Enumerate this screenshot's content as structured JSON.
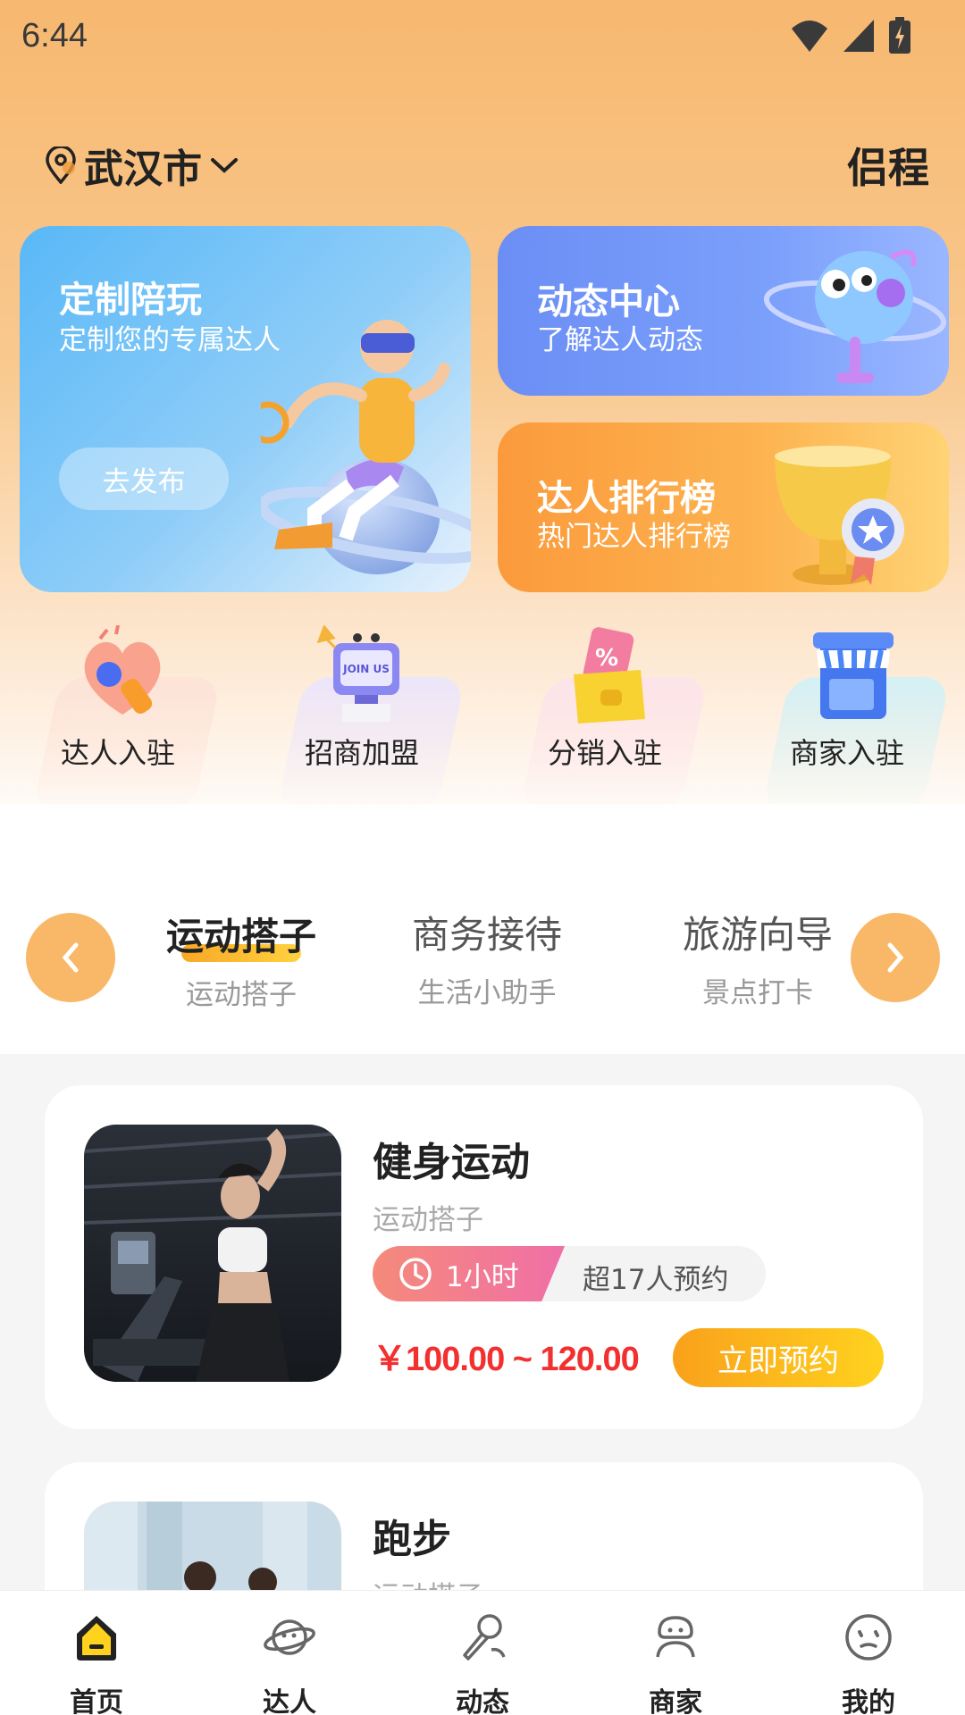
{
  "status_bar": {
    "time": "6:44"
  },
  "header": {
    "city": "武汉市",
    "brand": "侣程"
  },
  "cards": {
    "custom": {
      "title": "定制陪玩",
      "subtitle": "定制您的专属达人",
      "button": "去发布"
    },
    "dynamic": {
      "title": "动态中心",
      "subtitle": "了解达人动态"
    },
    "ranking": {
      "title": "达人排行榜",
      "subtitle": "热门达人排行榜"
    }
  },
  "quick_entries": [
    {
      "label": "达人入驻",
      "icon": "heart-megaphone-icon",
      "color": "#fde3d8"
    },
    {
      "label": "招商加盟",
      "icon": "join-us-computer-icon",
      "color": "#ece6fb"
    },
    {
      "label": "分销入驻",
      "icon": "coupon-wallet-icon",
      "color": "#fde3ea"
    },
    {
      "label": "商家入驻",
      "icon": "store-icon",
      "color": "#d9f3f7"
    }
  ],
  "categories": [
    {
      "title": "运动搭子",
      "subtitle": "运动搭子",
      "active": true
    },
    {
      "title": "商务接待",
      "subtitle": "生活小助手",
      "active": false
    },
    {
      "title": "旅游向导",
      "subtitle": "景点打卡",
      "active": false
    }
  ],
  "items": [
    {
      "title": "健身运动",
      "category": "运动搭子",
      "duration": "1小时",
      "bookings": "超17人预约",
      "price": "￥100.00 ~ 120.00",
      "button": "立即预约"
    },
    {
      "title": "跑步",
      "category": "运动搭子"
    }
  ],
  "bottom_nav": [
    {
      "label": "首页",
      "icon": "home-icon",
      "active": true
    },
    {
      "label": "达人",
      "icon": "planet-icon",
      "active": false
    },
    {
      "label": "动态",
      "icon": "microphone-icon",
      "active": false
    },
    {
      "label": "商家",
      "icon": "merchant-icon",
      "active": false
    },
    {
      "label": "我的",
      "icon": "face-icon",
      "active": false
    }
  ]
}
